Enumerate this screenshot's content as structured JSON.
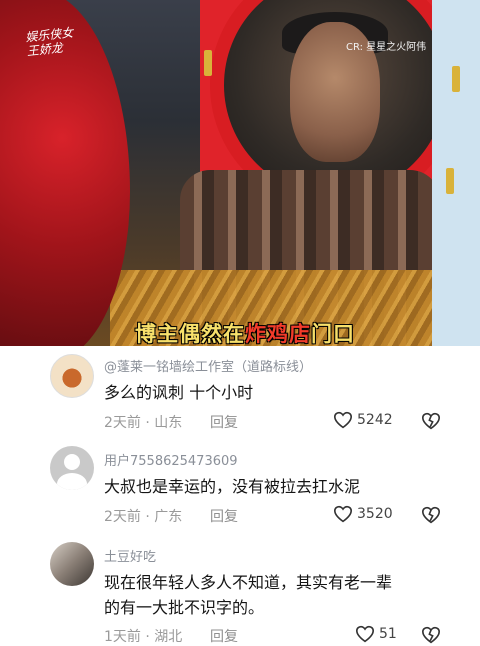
{
  "video": {
    "watermark_left": "娱乐侠女\n王娇龙",
    "watermark_right": "CR: 星星之火阿伟",
    "caption": {
      "part1": "博主偶然在",
      "part2": "炸鸡店",
      "part3": "门口"
    }
  },
  "comments": [
    {
      "username": "@蓬莱一铭墙绘工作室（道路标线）",
      "text": "多么的讽刺 十个小时",
      "time": "2天前",
      "location": "山东",
      "reply": "回复",
      "likes": "5242",
      "icons": {
        "like": "heart-icon",
        "dislike": "dislike-icon"
      }
    },
    {
      "username": "用户7558625473609",
      "text": "大叔也是幸运的，没有被拉去扛水泥",
      "time": "2天前",
      "location": "广东",
      "reply": "回复",
      "likes": "3520",
      "icons": {
        "like": "heart-icon",
        "dislike": "dislike-icon"
      }
    },
    {
      "username": "土豆好吃",
      "text_line1": "现在很年轻人多人不知道，其实有老一辈",
      "text_line2": "的有一大批不识字的。",
      "time": "1天前",
      "location": "湖北",
      "reply": "回复",
      "likes": "51",
      "icons": {
        "like": "heart-icon",
        "dislike": "dislike-icon"
      }
    }
  ],
  "separator": "·",
  "colors": {
    "caption_white": "#f7e06b",
    "caption_red": "#f23b2a",
    "mirror_red": "#d81d22"
  }
}
